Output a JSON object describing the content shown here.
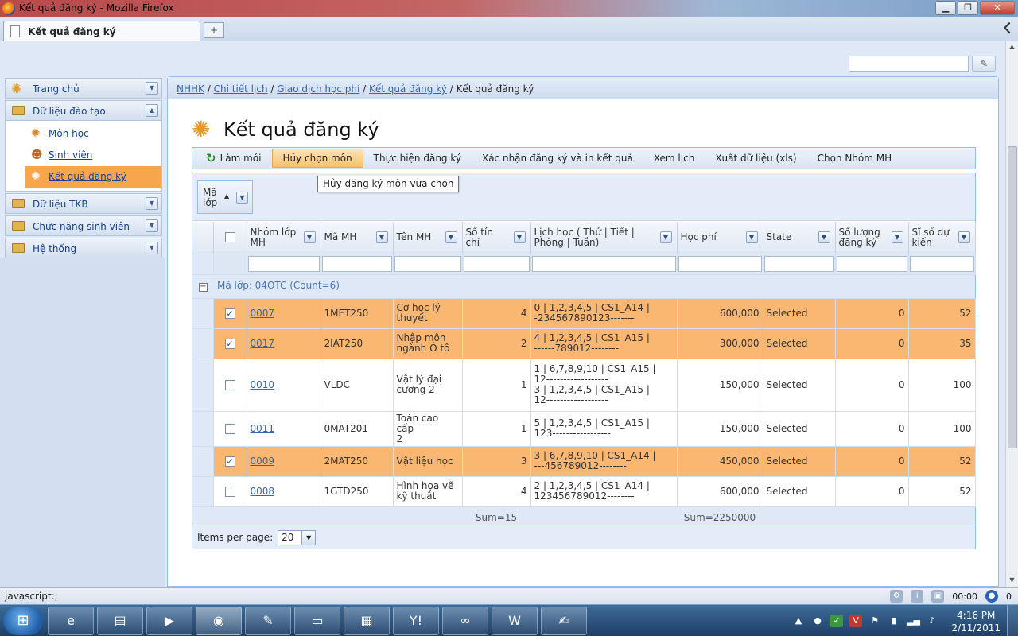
{
  "window": {
    "title": "Kết quả đăng ký - Mozilla Firefox"
  },
  "tabs": [
    {
      "label": "Kết quả đăng ký"
    }
  ],
  "newtab_symbol": "+",
  "sidebar": {
    "items": [
      {
        "label": "Trang chủ",
        "icon": "gear-star-icon"
      },
      {
        "label": "Dữ liệu đào tạo",
        "icon": "folder-icon",
        "expanded": true,
        "children": [
          {
            "label": "Môn học",
            "icon": "gear-star-icon"
          },
          {
            "label": "Sinh viên",
            "icon": "user-icon"
          },
          {
            "label": "Kết quả đăng ký",
            "icon": "gear-star-icon",
            "active": true
          }
        ]
      },
      {
        "label": "Dữ liệu TKB",
        "icon": "folder-icon"
      },
      {
        "label": "Chức năng sinh viên",
        "icon": "folder-icon"
      },
      {
        "label": "Hệ thống",
        "icon": "folder-icon"
      }
    ]
  },
  "breadcrumb": {
    "links": [
      "NHHK",
      "Chi tiết lịch",
      "Giao dịch học phí",
      "Kết quả đăng ký"
    ],
    "current": "Kết quả đăng ký",
    "sep": "/"
  },
  "page_title": "Kết quả đăng ký",
  "toolbar": {
    "refresh": "Làm mới",
    "cancel": "Hủy chọn môn",
    "register": "Thực hiện đăng ký",
    "confirm_print": "Xác nhận đăng ký và in kết quả",
    "view_schedule": "Xem lịch",
    "export": "Xuất dữ liệu (xls)",
    "choose_group": "Chọn Nhóm MH"
  },
  "tooltip": "Hủy đăng ký môn vừa chọn",
  "groupby_chip": {
    "line1": "Mã",
    "line2": "lớp"
  },
  "columns": {
    "nhom": [
      "Nhóm lớp",
      "MH"
    ],
    "mamh": [
      "Mã MH"
    ],
    "tenmh": [
      "Tên MH"
    ],
    "sotc": [
      "Số tín",
      "chỉ"
    ],
    "lich": [
      "Lịch học ( Thứ | Tiết |",
      "Phòng | Tuần)"
    ],
    "hocphi": [
      "Học phí"
    ],
    "state": [
      "State"
    ],
    "soluong": [
      "Số lượng",
      "đăng ký"
    ],
    "siso": [
      "Sĩ số dự",
      "kiến"
    ]
  },
  "group_label": "Mã lớp: 04OTC (Count=6)",
  "rows": [
    {
      "checked": true,
      "selected": true,
      "nhom": "0007",
      "mamh": "1MET250",
      "tenmh": [
        "Cơ học lý",
        "thuyết"
      ],
      "sotc": "4",
      "lich": [
        "0 | 1,2,3,4,5 | CS1_A14 |",
        "-234567890123-------"
      ],
      "hocphi": "600,000",
      "state": "Selected",
      "soluong": "0",
      "siso": "52"
    },
    {
      "checked": true,
      "selected": true,
      "nhom": "0017",
      "mamh": "2IAT250",
      "tenmh": [
        "Nhập môn",
        "ngành Ô tô"
      ],
      "sotc": "2",
      "lich": [
        "4 | 1,2,3,4,5 | CS1_A15 |",
        "------789012--------"
      ],
      "hocphi": "300,000",
      "state": "Selected",
      "soluong": "0",
      "siso": "35"
    },
    {
      "checked": false,
      "selected": false,
      "tall": true,
      "nhom": "0010",
      "mamh": "VLDC",
      "tenmh": [
        "Vật lý đại",
        "cương 2"
      ],
      "sotc": "1",
      "lich": [
        "1 | 6,7,8,9,10 | CS1_A15 |",
        "12------------------",
        "3 | 1,2,3,4,5 | CS1_A15 |",
        "12------------------"
      ],
      "hocphi": "150,000",
      "state": "Selected",
      "soluong": "0",
      "siso": "100"
    },
    {
      "checked": false,
      "selected": false,
      "nhom": "0011",
      "mamh": "0MAT201",
      "tenmh": [
        "Toán cao cấp",
        "2"
      ],
      "sotc": "1",
      "lich": [
        "5 | 1,2,3,4,5 | CS1_A15 |",
        "123-----------------"
      ],
      "hocphi": "150,000",
      "state": "Selected",
      "soluong": "0",
      "siso": "100"
    },
    {
      "checked": true,
      "selected": true,
      "nhom": "0009",
      "mamh": "2MAT250",
      "tenmh": [
        "Vật liệu học"
      ],
      "sotc": "3",
      "lich": [
        "3 | 6,7,8,9,10 | CS1_A14 |",
        "---456789012--------"
      ],
      "hocphi": "450,000",
      "state": "Selected",
      "soluong": "0",
      "siso": "52"
    },
    {
      "checked": false,
      "selected": false,
      "nhom": "0008",
      "mamh": "1GTD250",
      "tenmh": [
        "Hình họa vẽ",
        "kỹ thuật"
      ],
      "sotc": "4",
      "lich": [
        "2 | 1,2,3,4,5 | CS1_A14 |",
        "123456789012--------"
      ],
      "hocphi": "600,000",
      "state": "Selected",
      "soluong": "0",
      "siso": "52"
    }
  ],
  "summary": {
    "credits": "Sum=15",
    "fees": "Sum=2250000"
  },
  "pager": {
    "label": "Items per page:",
    "value": "20"
  },
  "statusbar": {
    "text": "javascript:;",
    "time": "00:00",
    "count": "0"
  },
  "taskbar": {
    "time": "4:16 PM",
    "date": "2/11/2011"
  },
  "colors": {
    "selected_row": "#f9b772",
    "link": "#3366aa",
    "panel_border": "#99bbe8"
  }
}
